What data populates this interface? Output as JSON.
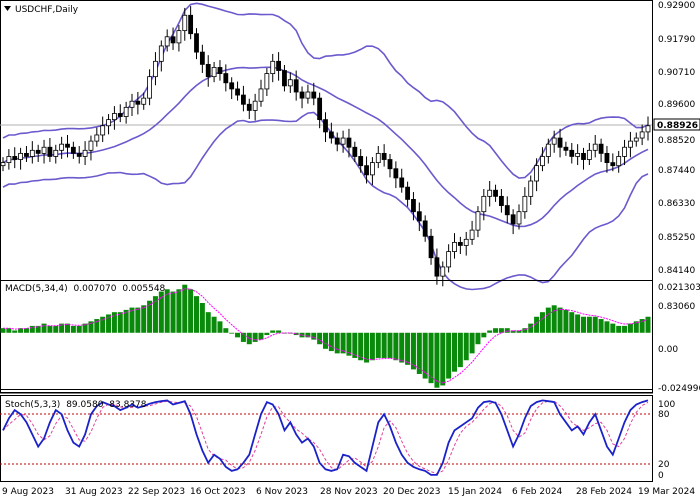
{
  "chart_title": "USDCHF,Daily",
  "title_icon": "triangle-down-icon",
  "colors": {
    "candle": "#000000",
    "bollinger": "#6a5acd",
    "macd_hist": "#0a8a0a",
    "macd_signal": "#ff00ff",
    "stoch_main": "#1a22c8",
    "stoch_signal": "#e0409a",
    "stoch_levels": "#c00000",
    "price_line": "#b0b0b0"
  },
  "current_price": "0.88926",
  "price_axis": [
    "0.92900",
    "0.91790",
    "0.90710",
    "0.89600",
    "0.88520",
    "0.87440",
    "0.86330",
    "0.85250",
    "0.84140",
    "0.83060"
  ],
  "macd": {
    "label": "MACD(5,34,4)",
    "value1": "0.007070",
    "value2": "0.005548",
    "axis": [
      "0.021303",
      "0.00",
      "-0.024996"
    ]
  },
  "stoch": {
    "label": "Stoch(5,3,3)",
    "value1": "89.0580",
    "value2": "83.8378",
    "axis": [
      "100",
      "80",
      "20",
      "0"
    ]
  },
  "time_axis": [
    "9 Aug 2023",
    "31 Aug 2023",
    "22 Sep 2023",
    "16 Oct 2023",
    "6 Nov 2023",
    "28 Nov 2023",
    "20 Dec 2023",
    "15 Jan 2024",
    "6 Feb 2024",
    "28 Feb 2024",
    "19 Mar 2024"
  ],
  "chart_data": [
    {
      "type": "candlestick",
      "title": "USDCHF,Daily",
      "ylim": [
        0.8306,
        0.929
      ],
      "series": [
        {
          "name": "USDCHF",
          "close": [
            0.877,
            0.879,
            0.878,
            0.88,
            0.879,
            0.881,
            0.88,
            0.882,
            0.879,
            0.881,
            0.883,
            0.882,
            0.88,
            0.879,
            0.881,
            0.884,
            0.886,
            0.889,
            0.891,
            0.893,
            0.892,
            0.895,
            0.897,
            0.896,
            0.898,
            0.905,
            0.91,
            0.915,
            0.918,
            0.916,
            0.92,
            0.925,
            0.919,
            0.913,
            0.909,
            0.905,
            0.908,
            0.906,
            0.903,
            0.901,
            0.899,
            0.896,
            0.894,
            0.897,
            0.901,
            0.906,
            0.91,
            0.907,
            0.902,
            0.904,
            0.9,
            0.898,
            0.9,
            0.898,
            0.891,
            0.887,
            0.885,
            0.883,
            0.885,
            0.882,
            0.879,
            0.876,
            0.873,
            0.877,
            0.88,
            0.878,
            0.875,
            0.872,
            0.869,
            0.865,
            0.861,
            0.858,
            0.853,
            0.846,
            0.84,
            0.843,
            0.848,
            0.851,
            0.85,
            0.852,
            0.855,
            0.861,
            0.866,
            0.868,
            0.866,
            0.863,
            0.86,
            0.857,
            0.861,
            0.866,
            0.871,
            0.876,
            0.879,
            0.883,
            0.885,
            0.882,
            0.881,
            0.879,
            0.88,
            0.878,
            0.881,
            0.883,
            0.88,
            0.877,
            0.876,
            0.879,
            0.882,
            0.884,
            0.885,
            0.887,
            0.889
          ]
        },
        {
          "name": "BB upper"
        },
        {
          "name": "BB middle"
        },
        {
          "name": "BB lower"
        }
      ]
    },
    {
      "type": "bar",
      "title": "MACD(5,34,4) 0.007070 0.005548",
      "ylim": [
        -0.024996,
        0.021303
      ],
      "series": [
        {
          "name": "MACD",
          "values": [
            0.002,
            0.002,
            0.001,
            0.002,
            0.002,
            0.003,
            0.003,
            0.004,
            0.003,
            0.003,
            0.004,
            0.004,
            0.003,
            0.003,
            0.004,
            0.005,
            0.006,
            0.007,
            0.008,
            0.009,
            0.009,
            0.01,
            0.011,
            0.011,
            0.012,
            0.014,
            0.016,
            0.018,
            0.019,
            0.018,
            0.019,
            0.021,
            0.019,
            0.016,
            0.013,
            0.009,
            0.007,
            0.005,
            0.002,
            0.0,
            -0.002,
            -0.004,
            -0.005,
            -0.004,
            -0.003,
            -0.001,
            0.001,
            0.001,
            0.0,
            0.0,
            -0.001,
            -0.002,
            -0.002,
            -0.003,
            -0.005,
            -0.007,
            -0.008,
            -0.009,
            -0.009,
            -0.01,
            -0.011,
            -0.012,
            -0.013,
            -0.012,
            -0.011,
            -0.011,
            -0.011,
            -0.012,
            -0.013,
            -0.014,
            -0.016,
            -0.018,
            -0.02,
            -0.022,
            -0.024,
            -0.023,
            -0.02,
            -0.017,
            -0.015,
            -0.012,
            -0.009,
            -0.005,
            -0.002,
            0.001,
            0.002,
            0.002,
            0.002,
            0.001,
            0.001,
            0.002,
            0.004,
            0.007,
            0.009,
            0.011,
            0.012,
            0.011,
            0.01,
            0.009,
            0.008,
            0.007,
            0.007,
            0.007,
            0.006,
            0.005,
            0.004,
            0.003,
            0.003,
            0.004,
            0.005,
            0.006,
            0.007
          ]
        },
        {
          "name": "Signal"
        }
      ]
    },
    {
      "type": "line",
      "title": "Stoch(5,3,3) 89.0580 83.8378",
      "ylim": [
        0,
        100
      ],
      "levels": [
        80,
        20
      ],
      "series": [
        {
          "name": "Main",
          "values": [
            60,
            75,
            85,
            80,
            70,
            55,
            40,
            50,
            70,
            85,
            80,
            60,
            45,
            40,
            55,
            80,
            90,
            95,
            92,
            90,
            85,
            88,
            92,
            88,
            90,
            93,
            95,
            96,
            97,
            92,
            94,
            96,
            80,
            55,
            35,
            20,
            30,
            25,
            15,
            10,
            12,
            20,
            30,
            55,
            80,
            95,
            92,
            80,
            60,
            70,
            55,
            45,
            50,
            40,
            20,
            12,
            10,
            12,
            30,
            28,
            20,
            15,
            10,
            40,
            70,
            80,
            65,
            45,
            30,
            20,
            15,
            12,
            10,
            5,
            5,
            20,
            45,
            60,
            65,
            70,
            75,
            88,
            95,
            96,
            94,
            80,
            60,
            40,
            55,
            75,
            90,
            95,
            97,
            96,
            95,
            80,
            70,
            60,
            65,
            55,
            70,
            80,
            60,
            40,
            30,
            50,
            70,
            85,
            92,
            95,
            97
          ]
        },
        {
          "name": "Signal"
        }
      ]
    }
  ]
}
